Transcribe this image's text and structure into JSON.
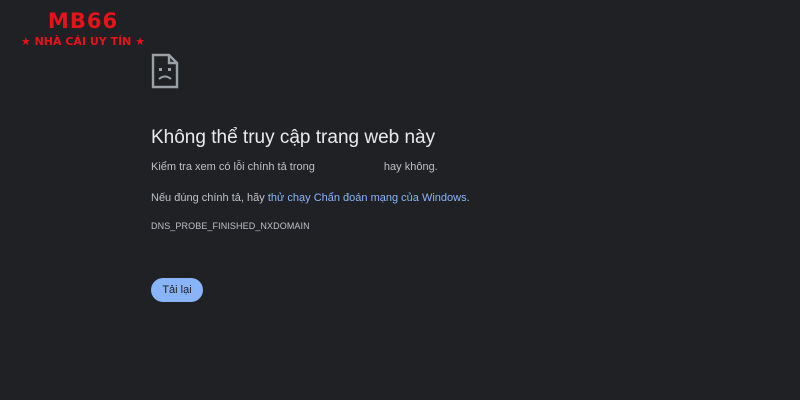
{
  "brand": {
    "logo": "MB66",
    "tagline": "★ NHÀ CÁI UY TÍN ★"
  },
  "error": {
    "icon": "sad-page-icon",
    "title": "Không thể truy cập trang web này",
    "check_prefix": "Kiểm tra xem có lỗi chính tả trong",
    "check_suffix": "hay không.",
    "spelling_prefix": "Nếu đúng chính tả, hãy",
    "diagnostics_link": "thử chạy Chẩn đoán mạng của Windows",
    "spelling_suffix": ".",
    "code": "DNS_PROBE_FINISHED_NXDOMAIN"
  },
  "actions": {
    "reload_label": "Tải lại"
  },
  "colors": {
    "background": "#202124",
    "link": "#8ab4f8",
    "brand": "#e8121b"
  }
}
